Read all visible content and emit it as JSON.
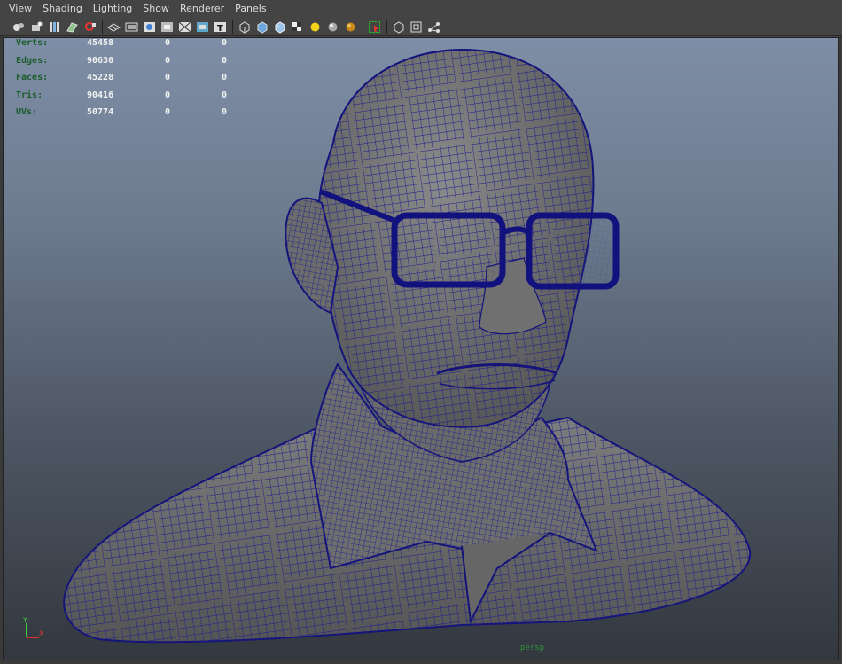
{
  "menu": {
    "items": [
      {
        "label": "View"
      },
      {
        "label": "Shading"
      },
      {
        "label": "Lighting"
      },
      {
        "label": "Show"
      },
      {
        "label": "Renderer"
      },
      {
        "label": "Panels"
      }
    ]
  },
  "toolbar": {
    "icons": [
      "camera-select-icon",
      "camera-attributes-icon",
      "bookmarks-icon",
      "image-plane-icon",
      "2d-pan-zoom-icon",
      "grid-icon",
      "film-gate-icon",
      "resolution-gate-icon",
      "gate-mask-icon",
      "field-chart-icon",
      "safe-action-icon",
      "safe-title-icon",
      "wireframe-icon",
      "smooth-shade-icon",
      "wireframe-on-shaded-icon",
      "textured-icon",
      "use-all-lights-icon",
      "shadows-icon",
      "ambient-occlusion-icon",
      "material-icon",
      "select-highlight-icon",
      "isolate-select-icon",
      "xray-icon",
      "xray-joints-icon"
    ]
  },
  "hud": {
    "rows": [
      {
        "label": "Verts:",
        "a": "45458",
        "b": "0",
        "c": "0"
      },
      {
        "label": "Edges:",
        "a": "90630",
        "b": "0",
        "c": "0"
      },
      {
        "label": "Faces:",
        "a": "45228",
        "b": "0",
        "c": "0"
      },
      {
        "label": "Tris:",
        "a": "90416",
        "b": "0",
        "c": "0"
      },
      {
        "label": "UVs:",
        "a": "50774",
        "b": "0",
        "c": "0"
      }
    ]
  },
  "axis": {
    "y_label": "Y",
    "x_label": "X"
  },
  "camera": {
    "name": "persp"
  },
  "colors": {
    "wire": "#1a1a8c",
    "surface": "#6e6e6e",
    "menu_bg": "#444444",
    "hud_label": "#1c5c2d",
    "camera_label": "#2f8f3a"
  }
}
